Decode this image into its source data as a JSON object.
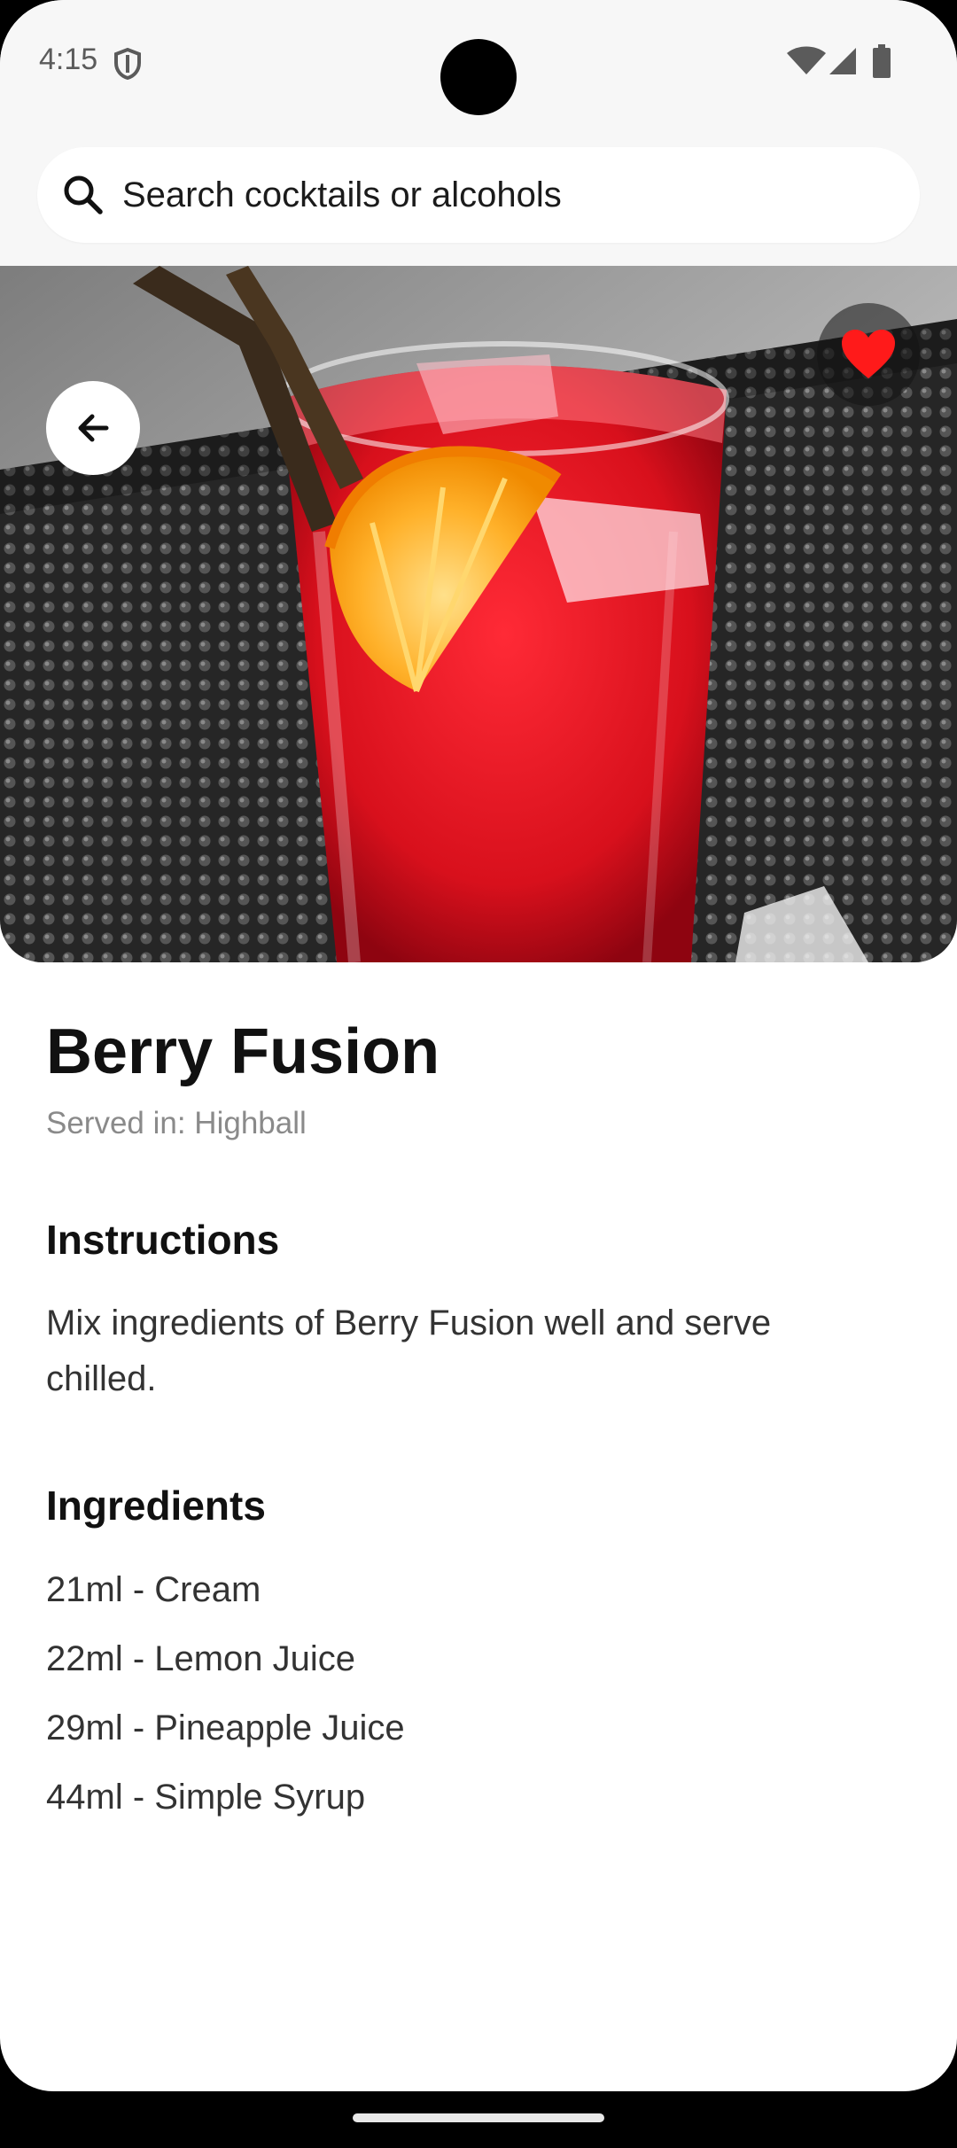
{
  "status_bar": {
    "time": "4:15",
    "icons": [
      "shield-icon",
      "wifi-icon",
      "signal-icon",
      "battery-icon"
    ]
  },
  "search": {
    "placeholder": "Search cocktails or alcohols",
    "icon": "search-icon"
  },
  "hero": {
    "image": "red cocktail in highball glass with orange slice and straws",
    "back_icon": "arrow-left-icon",
    "favorite_icon": "heart-icon",
    "favorite_active": true,
    "favorite_color": "#ff1a1a"
  },
  "drink": {
    "name": "Berry Fusion",
    "served_in": "Served in: Highball"
  },
  "instructions": {
    "heading": "Instructions",
    "text": "Mix ingredients of Berry Fusion well and serve chilled."
  },
  "ingredients": {
    "heading": "Ingredients",
    "items": [
      "21ml - Cream",
      "22ml - Lemon Juice",
      "29ml - Pineapple Juice",
      "44ml - Simple Syrup"
    ]
  }
}
